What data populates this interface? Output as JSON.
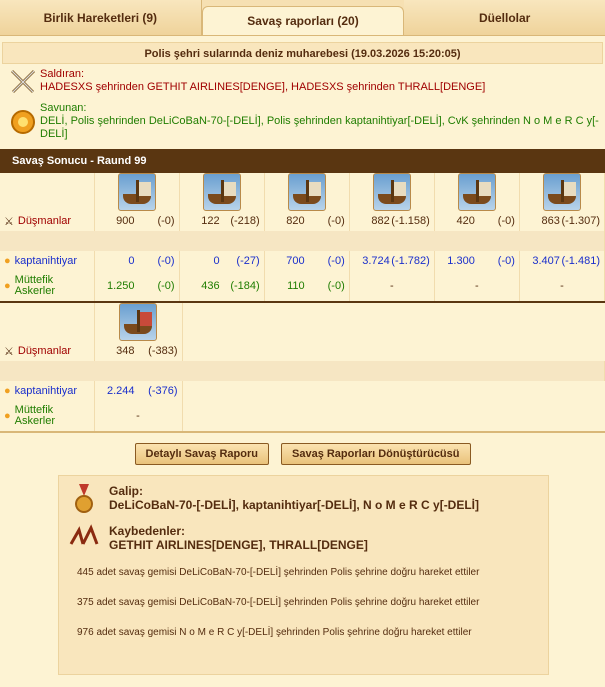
{
  "tabs": [
    {
      "label": "Birlik Hareketleri (9)"
    },
    {
      "label": "Savaş raporları (20)"
    },
    {
      "label": "Düellolar"
    }
  ],
  "report": {
    "title": "Polis şehri sularında deniz muharebesi (19.03.2026 15:20:05)"
  },
  "attacker": {
    "label": "Saldıran:",
    "text": "HADESXS şehrinden GETHIT AIRLINES[DENGE], HADESXS şehrinden THRALL[DENGE]"
  },
  "defender": {
    "label": "Savunan:",
    "text": "DELİ, Polis şehrinden DeLiCoBaN-70-[-DELİ], Polis şehrinden kaptanihtiyar[-DELİ], CvK şehrinden N o M e R C y[-DELİ]"
  },
  "result_bar": "Savaş Sonucu - Raund 99",
  "rows": {
    "enemies": "Düşmanlar",
    "kaptan": "kaptanihtiyar",
    "allies": "Müttefik Askerler"
  },
  "block1": {
    "enemies": [
      [
        "900",
        "(-0)"
      ],
      [
        "122",
        "(-218)"
      ],
      [
        "820",
        "(-0)"
      ],
      [
        "882",
        "(-1.158)"
      ],
      [
        "420",
        "(-0)"
      ],
      [
        "863",
        "(-1.307)"
      ]
    ],
    "kaptan": [
      [
        "0",
        "(-0)"
      ],
      [
        "0",
        "(-27)"
      ],
      [
        "700",
        "(-0)"
      ],
      [
        "3.724",
        "(-1.782)"
      ],
      [
        "1.300",
        "(-0)"
      ],
      [
        "3.407",
        "(-1.481)"
      ]
    ],
    "allies": [
      [
        "1.250",
        "(-0)"
      ],
      [
        "436",
        "(-184)"
      ],
      [
        "110",
        "(-0)"
      ],
      [
        "-",
        ""
      ],
      [
        "-",
        ""
      ],
      [
        "-",
        ""
      ]
    ]
  },
  "block2": {
    "enemies": [
      "348",
      "(-383)"
    ],
    "kaptan": [
      "2.244",
      "(-376)"
    ],
    "allies": [
      "-",
      ""
    ]
  },
  "buttons": {
    "detail": "Detaylı Savaş Raporu",
    "converter": "Savaş Raporları Dönüştürücüsü"
  },
  "summary": {
    "winner_title": "Galip:",
    "winner_names": "DeLiCoBaN-70-[-DELİ], kaptanihtiyar[-DELİ], N o M e R C y[-DELİ]",
    "loser_title": "Kaybedenler:",
    "loser_names": "GETHIT AIRLINES[DENGE], THRALL[DENGE]",
    "log": [
      "445 adet savaş gemisi DeLiCoBaN-70-[-DELİ] şehrinden Polis şehrine doğru hareket ettiler",
      "375 adet savaş gemisi DeLiCoBaN-70-[-DELİ] şehrinden Polis şehrine doğru hareket ettiler",
      "976 adet savaş gemisi N o M e R C y[-DELİ] şehrinden Polis şehrine doğru hareket ettiler"
    ]
  },
  "colors": {
    "bar": "#5a3611",
    "enemy": "#a00000",
    "kaptan": "#1a2fcc",
    "ally": "#1f7d00",
    "page": "#fdf3d3"
  }
}
